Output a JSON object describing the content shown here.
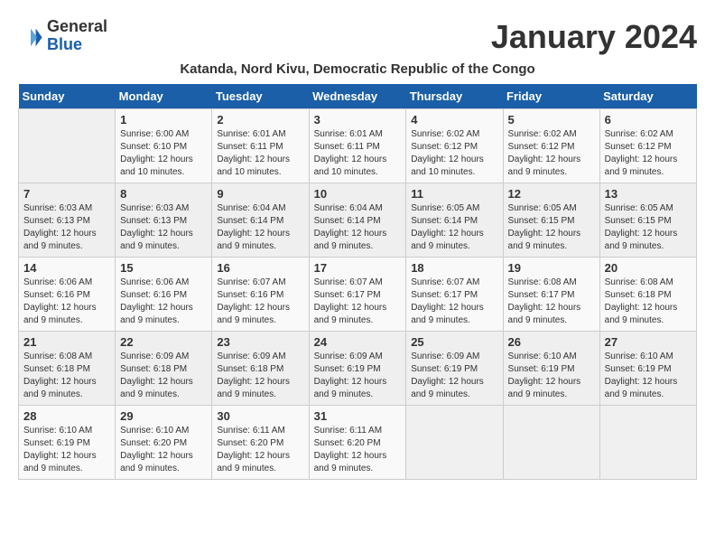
{
  "logo": {
    "text_general": "General",
    "text_blue": "Blue"
  },
  "header": {
    "month_title": "January 2024",
    "subtitle": "Katanda, Nord Kivu, Democratic Republic of the Congo"
  },
  "weekdays": [
    "Sunday",
    "Monday",
    "Tuesday",
    "Wednesday",
    "Thursday",
    "Friday",
    "Saturday"
  ],
  "weeks": [
    [
      {
        "day": "",
        "sunrise": "",
        "sunset": "",
        "daylight": ""
      },
      {
        "day": "1",
        "sunrise": "Sunrise: 6:00 AM",
        "sunset": "Sunset: 6:10 PM",
        "daylight": "Daylight: 12 hours and 10 minutes."
      },
      {
        "day": "2",
        "sunrise": "Sunrise: 6:01 AM",
        "sunset": "Sunset: 6:11 PM",
        "daylight": "Daylight: 12 hours and 10 minutes."
      },
      {
        "day": "3",
        "sunrise": "Sunrise: 6:01 AM",
        "sunset": "Sunset: 6:11 PM",
        "daylight": "Daylight: 12 hours and 10 minutes."
      },
      {
        "day": "4",
        "sunrise": "Sunrise: 6:02 AM",
        "sunset": "Sunset: 6:12 PM",
        "daylight": "Daylight: 12 hours and 10 minutes."
      },
      {
        "day": "5",
        "sunrise": "Sunrise: 6:02 AM",
        "sunset": "Sunset: 6:12 PM",
        "daylight": "Daylight: 12 hours and 9 minutes."
      },
      {
        "day": "6",
        "sunrise": "Sunrise: 6:02 AM",
        "sunset": "Sunset: 6:12 PM",
        "daylight": "Daylight: 12 hours and 9 minutes."
      }
    ],
    [
      {
        "day": "7",
        "sunrise": "Sunrise: 6:03 AM",
        "sunset": "Sunset: 6:13 PM",
        "daylight": "Daylight: 12 hours and 9 minutes."
      },
      {
        "day": "8",
        "sunrise": "Sunrise: 6:03 AM",
        "sunset": "Sunset: 6:13 PM",
        "daylight": "Daylight: 12 hours and 9 minutes."
      },
      {
        "day": "9",
        "sunrise": "Sunrise: 6:04 AM",
        "sunset": "Sunset: 6:14 PM",
        "daylight": "Daylight: 12 hours and 9 minutes."
      },
      {
        "day": "10",
        "sunrise": "Sunrise: 6:04 AM",
        "sunset": "Sunset: 6:14 PM",
        "daylight": "Daylight: 12 hours and 9 minutes."
      },
      {
        "day": "11",
        "sunrise": "Sunrise: 6:05 AM",
        "sunset": "Sunset: 6:14 PM",
        "daylight": "Daylight: 12 hours and 9 minutes."
      },
      {
        "day": "12",
        "sunrise": "Sunrise: 6:05 AM",
        "sunset": "Sunset: 6:15 PM",
        "daylight": "Daylight: 12 hours and 9 minutes."
      },
      {
        "day": "13",
        "sunrise": "Sunrise: 6:05 AM",
        "sunset": "Sunset: 6:15 PM",
        "daylight": "Daylight: 12 hours and 9 minutes."
      }
    ],
    [
      {
        "day": "14",
        "sunrise": "Sunrise: 6:06 AM",
        "sunset": "Sunset: 6:16 PM",
        "daylight": "Daylight: 12 hours and 9 minutes."
      },
      {
        "day": "15",
        "sunrise": "Sunrise: 6:06 AM",
        "sunset": "Sunset: 6:16 PM",
        "daylight": "Daylight: 12 hours and 9 minutes."
      },
      {
        "day": "16",
        "sunrise": "Sunrise: 6:07 AM",
        "sunset": "Sunset: 6:16 PM",
        "daylight": "Daylight: 12 hours and 9 minutes."
      },
      {
        "day": "17",
        "sunrise": "Sunrise: 6:07 AM",
        "sunset": "Sunset: 6:17 PM",
        "daylight": "Daylight: 12 hours and 9 minutes."
      },
      {
        "day": "18",
        "sunrise": "Sunrise: 6:07 AM",
        "sunset": "Sunset: 6:17 PM",
        "daylight": "Daylight: 12 hours and 9 minutes."
      },
      {
        "day": "19",
        "sunrise": "Sunrise: 6:08 AM",
        "sunset": "Sunset: 6:17 PM",
        "daylight": "Daylight: 12 hours and 9 minutes."
      },
      {
        "day": "20",
        "sunrise": "Sunrise: 6:08 AM",
        "sunset": "Sunset: 6:18 PM",
        "daylight": "Daylight: 12 hours and 9 minutes."
      }
    ],
    [
      {
        "day": "21",
        "sunrise": "Sunrise: 6:08 AM",
        "sunset": "Sunset: 6:18 PM",
        "daylight": "Daylight: 12 hours and 9 minutes."
      },
      {
        "day": "22",
        "sunrise": "Sunrise: 6:09 AM",
        "sunset": "Sunset: 6:18 PM",
        "daylight": "Daylight: 12 hours and 9 minutes."
      },
      {
        "day": "23",
        "sunrise": "Sunrise: 6:09 AM",
        "sunset": "Sunset: 6:18 PM",
        "daylight": "Daylight: 12 hours and 9 minutes."
      },
      {
        "day": "24",
        "sunrise": "Sunrise: 6:09 AM",
        "sunset": "Sunset: 6:19 PM",
        "daylight": "Daylight: 12 hours and 9 minutes."
      },
      {
        "day": "25",
        "sunrise": "Sunrise: 6:09 AM",
        "sunset": "Sunset: 6:19 PM",
        "daylight": "Daylight: 12 hours and 9 minutes."
      },
      {
        "day": "26",
        "sunrise": "Sunrise: 6:10 AM",
        "sunset": "Sunset: 6:19 PM",
        "daylight": "Daylight: 12 hours and 9 minutes."
      },
      {
        "day": "27",
        "sunrise": "Sunrise: 6:10 AM",
        "sunset": "Sunset: 6:19 PM",
        "daylight": "Daylight: 12 hours and 9 minutes."
      }
    ],
    [
      {
        "day": "28",
        "sunrise": "Sunrise: 6:10 AM",
        "sunset": "Sunset: 6:19 PM",
        "daylight": "Daylight: 12 hours and 9 minutes."
      },
      {
        "day": "29",
        "sunrise": "Sunrise: 6:10 AM",
        "sunset": "Sunset: 6:20 PM",
        "daylight": "Daylight: 12 hours and 9 minutes."
      },
      {
        "day": "30",
        "sunrise": "Sunrise: 6:11 AM",
        "sunset": "Sunset: 6:20 PM",
        "daylight": "Daylight: 12 hours and 9 minutes."
      },
      {
        "day": "31",
        "sunrise": "Sunrise: 6:11 AM",
        "sunset": "Sunset: 6:20 PM",
        "daylight": "Daylight: 12 hours and 9 minutes."
      },
      {
        "day": "",
        "sunrise": "",
        "sunset": "",
        "daylight": ""
      },
      {
        "day": "",
        "sunrise": "",
        "sunset": "",
        "daylight": ""
      },
      {
        "day": "",
        "sunrise": "",
        "sunset": "",
        "daylight": ""
      }
    ]
  ]
}
